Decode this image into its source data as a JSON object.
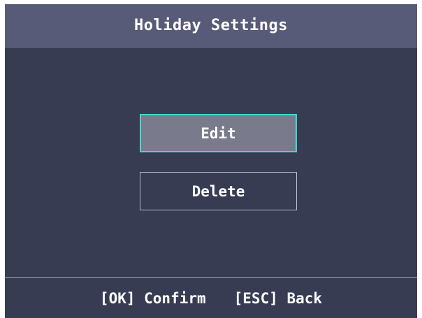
{
  "header": {
    "title": "Holiday Settings"
  },
  "menu": {
    "items": [
      {
        "label": "Edit",
        "selected": true
      },
      {
        "label": "Delete",
        "selected": false
      }
    ]
  },
  "footer": {
    "confirm_hint": "[OK] Confirm",
    "back_hint": "[ESC] Back"
  },
  "colors": {
    "background": "#383c53",
    "titlebar": "#585b77",
    "selected_fill": "#797b8c",
    "selected_border": "#40d8d0",
    "text": "#ffffff"
  }
}
